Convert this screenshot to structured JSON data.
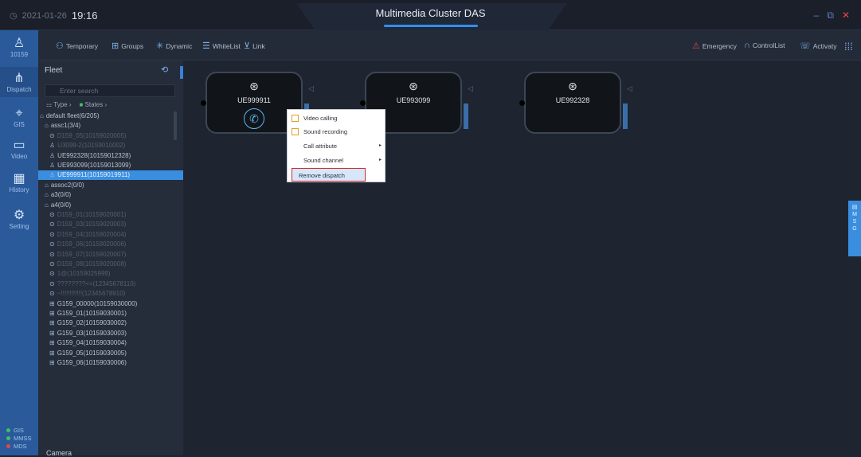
{
  "titlebar": {
    "date": "2021-01-26",
    "time": "19:16",
    "title": "Multimedia Cluster DAS"
  },
  "sidebar": {
    "user": "10159",
    "items": [
      {
        "label": "Dispatch",
        "icon": "dispatch-icon"
      },
      {
        "label": "GIS",
        "icon": "gis-icon"
      },
      {
        "label": "Video",
        "icon": "video-icon"
      },
      {
        "label": "History",
        "icon": "history-icon"
      },
      {
        "label": "Setting",
        "icon": "setting-icon"
      }
    ],
    "status": [
      {
        "label": "GIS",
        "color": "#3fbf6a"
      },
      {
        "label": "MMSS",
        "color": "#3fbf6a"
      },
      {
        "label": "MDS",
        "color": "#e04848"
      }
    ]
  },
  "toolbar": {
    "temporary": "Temporary",
    "groups": "Groups",
    "dynamic": "Dynamic",
    "whitelist": "WhiteList",
    "link": "Link",
    "emergency": "Emergency",
    "controllist": "ControlList",
    "activate": "Activaty"
  },
  "fleet": {
    "header": "Fleet",
    "search_placeholder": "Enter search",
    "filter_type": "Type",
    "filter_states": "States",
    "camera": "Camera",
    "tree": [
      "default fleet(6/205)",
      "assc1(3/4)",
      "D159_05(10159020005)",
      "U3099-2(10159010002)",
      "UE992328(10159012328)",
      "UE993099(10159013099)",
      "UE999911(10159019911)",
      "assoc2(0/0)",
      "a3(0/0)",
      "a4(0/0)",
      "D159_01(10159020001)",
      "D159_03(10159020003)",
      "D159_04(10159020004)",
      "D159_06(10159020006)",
      "D159_07(10159020007)",
      "D159_08(10159020008)",
      "1@(10159025999)",
      "????????<<(12345678110)",
      "~!!!!!!!!!!!!(12345678910)",
      "G159_00000(10159030000)",
      "G159_01(10159030001)",
      "G159_02(10159030002)",
      "G159_03(10159030003)",
      "G159_04(10159030004)",
      "G159_05(10159030005)",
      "G159_06(10159030006)"
    ]
  },
  "cards": [
    {
      "name": "UE999911"
    },
    {
      "name": "UE993099"
    },
    {
      "name": "UE992328"
    }
  ],
  "context_menu": {
    "items": [
      "Video calling",
      "Sound recording",
      "Call attribute",
      "Sound channel",
      "Remove dispatch"
    ]
  },
  "msg_tab": "MSG"
}
